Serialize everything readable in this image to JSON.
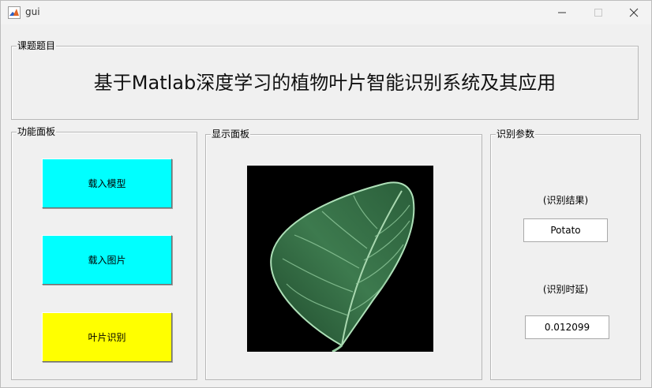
{
  "window": {
    "title": "gui",
    "icon": "matlab-icon"
  },
  "topic_panel": {
    "label": "课题题目",
    "title": "基于Matlab深度学习的植物叶片智能识别系统及其应用"
  },
  "function_panel": {
    "label": "功能面板",
    "buttons": [
      {
        "label": "载入模型",
        "color": "#00ffff"
      },
      {
        "label": "载入图片",
        "color": "#00ffff"
      },
      {
        "label": "叶片识别",
        "color": "#ffff00"
      }
    ]
  },
  "display_panel": {
    "label": "显示面板",
    "image": "potato-leaf-image"
  },
  "param_panel": {
    "label": "识别参数",
    "result_label": "(识别结果)",
    "result_value": "Potato",
    "time_label": "(识别时延)",
    "time_value": "0.012099"
  }
}
